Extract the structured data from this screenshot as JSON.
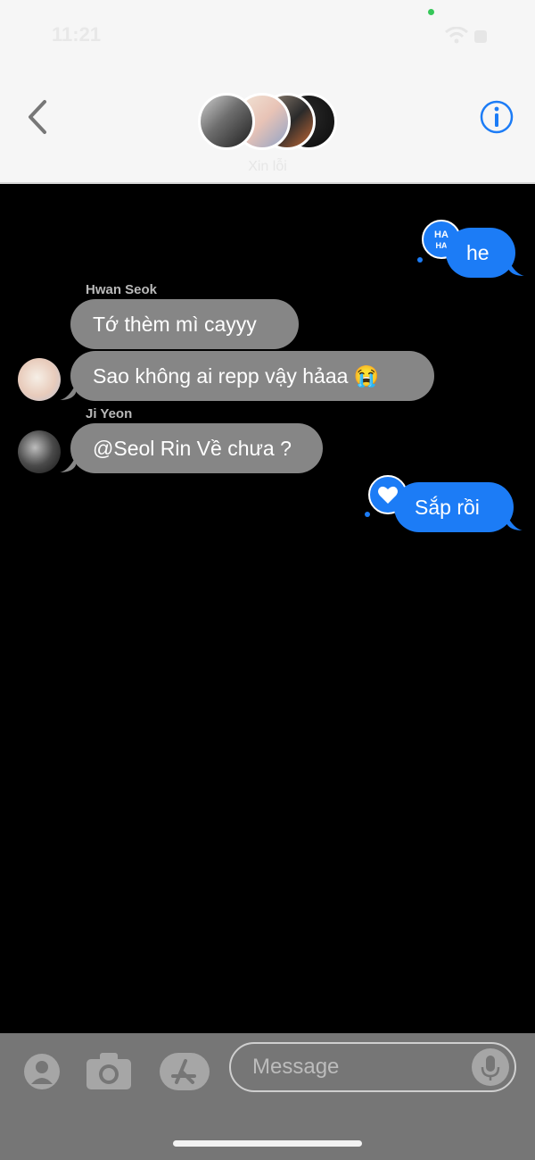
{
  "status_bar": {
    "time": "11:21"
  },
  "header": {
    "group_name": "Xin lỗi"
  },
  "messages": [
    {
      "text": "he",
      "tapback": "HAHA"
    },
    {
      "sender": "Hwan Seok",
      "text": "Tớ thèm mì cayyy"
    },
    {
      "text": "Sao không ai repp vậy hảaa 😭"
    },
    {
      "sender": "Ji Yeon",
      "text": "@Seol Rin Về chưa ?"
    },
    {
      "text": "Sắp rồi",
      "tapback": "heart"
    }
  ],
  "composer": {
    "placeholder": "Message"
  },
  "icons": {
    "back": "chevron-left-icon",
    "info": "info-icon",
    "contact": "person-icon",
    "camera": "camera-icon",
    "apps": "app-store-icon",
    "mic": "mic-icon"
  },
  "colors": {
    "sent": "#1c7cf6",
    "received": "#868686",
    "background": "#000000"
  }
}
